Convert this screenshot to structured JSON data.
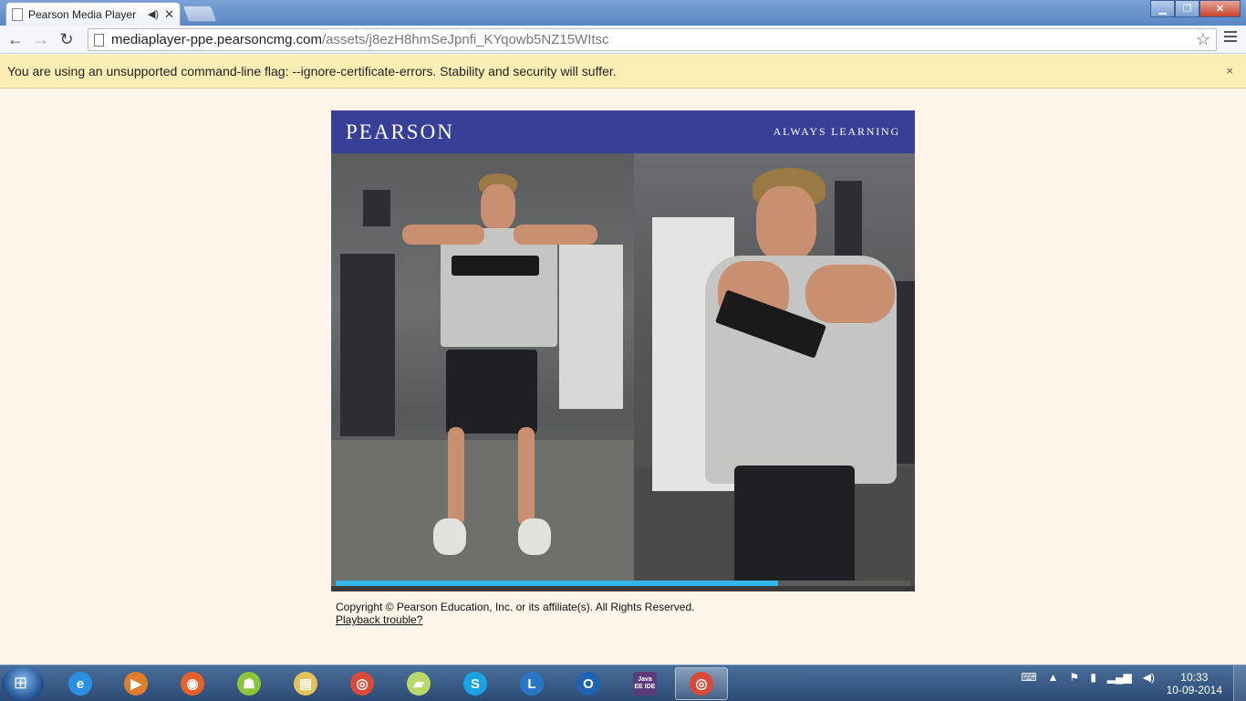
{
  "browser": {
    "tab_title": "Pearson Media Player",
    "url_host": "mediaplayer-ppe.pearsoncmg.com",
    "url_path": "/assets/j8ezH8hmSeJpnfi_KYqowb5NZ15WItsc"
  },
  "infobar": {
    "message": "You are using an unsupported command-line flag: --ignore-certificate-errors. Stability and security will suffer.",
    "close": "×"
  },
  "player": {
    "logo": "PEARSON",
    "tagline": "ALWAYS LEARNING",
    "progress_percent": 77
  },
  "footer": {
    "copyright": "Copyright © Pearson Education, Inc. or its affiliate(s). All Rights Reserved.",
    "playback_link": "Playback trouble?"
  },
  "taskbar": {
    "apps": [
      {
        "name": "internet-explorer",
        "glyph": "e",
        "color": "#2b8fe0"
      },
      {
        "name": "media-player",
        "glyph": "▶",
        "color": "#e07d2b"
      },
      {
        "name": "firefox",
        "glyph": "◉",
        "color": "#e8602a"
      },
      {
        "name": "android",
        "glyph": "☗",
        "color": "#8cc43b"
      },
      {
        "name": "file-explorer",
        "glyph": "▤",
        "color": "#e6c35a"
      },
      {
        "name": "chrome",
        "glyph": "◎",
        "color": "#d94a3a"
      },
      {
        "name": "sticky-notes",
        "glyph": "▰",
        "color": "#b9d86a"
      },
      {
        "name": "skype",
        "glyph": "S",
        "color": "#1aa3e3"
      },
      {
        "name": "lync",
        "glyph": "L",
        "color": "#2a76c6"
      },
      {
        "name": "outlook",
        "glyph": "O",
        "color": "#1f63b4"
      },
      {
        "name": "java-ee-ide",
        "glyph": "Java EE IDE",
        "color": "#5a3a7a"
      },
      {
        "name": "chrome-active",
        "glyph": "◎",
        "color": "#d94a3a"
      }
    ],
    "time": "10:33",
    "date": "10-09-2014"
  }
}
